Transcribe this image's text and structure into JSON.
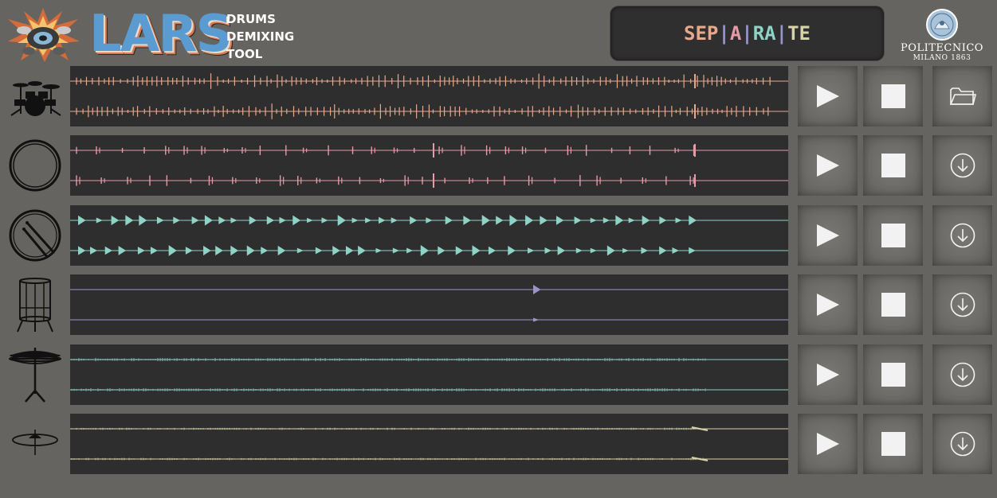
{
  "header": {
    "logo_icon": "exploding-drum-kit-icon",
    "wordmark": "LARS",
    "tagline": [
      "DRUMS",
      "DEMIXING",
      "TOOL"
    ],
    "separate_button": {
      "segments": [
        "SEP",
        "|",
        "A",
        "|",
        "RA",
        "|",
        "TE"
      ]
    },
    "institution": {
      "seal_icon": "politecnico-seal-icon",
      "name": "POLITECNICO",
      "subtitle": "MILANO 1863"
    }
  },
  "tracks": [
    {
      "id": "mix",
      "icon": "drum-kit-icon",
      "wave_color": "#e8a88c",
      "action_icon": "folder-icon",
      "density": "dense"
    },
    {
      "id": "kick",
      "icon": "bass-drum-icon",
      "wave_color": "#e79aa8",
      "action_icon": "download-icon",
      "density": "sparse"
    },
    {
      "id": "snare",
      "icon": "snare-drum-icon",
      "wave_color": "#8fd3c7",
      "action_icon": "download-icon",
      "density": "medium"
    },
    {
      "id": "toms",
      "icon": "tom-drum-icon",
      "wave_color": "#9a95c9",
      "action_icon": "download-icon",
      "density": "single"
    },
    {
      "id": "hihat",
      "icon": "hi-hat-icon",
      "wave_color": "#8fcfc2",
      "action_icon": "download-icon",
      "density": "noise"
    },
    {
      "id": "cymbals",
      "icon": "cymbal-icon",
      "wave_color": "#d7d3a8",
      "action_icon": "download-icon",
      "density": "noise-light"
    }
  ],
  "colors": {
    "background": "#666460",
    "waveform_panel": "#2e2e2e",
    "button_face": "#6f6d6a",
    "icon_white": "#f2f2f2"
  }
}
